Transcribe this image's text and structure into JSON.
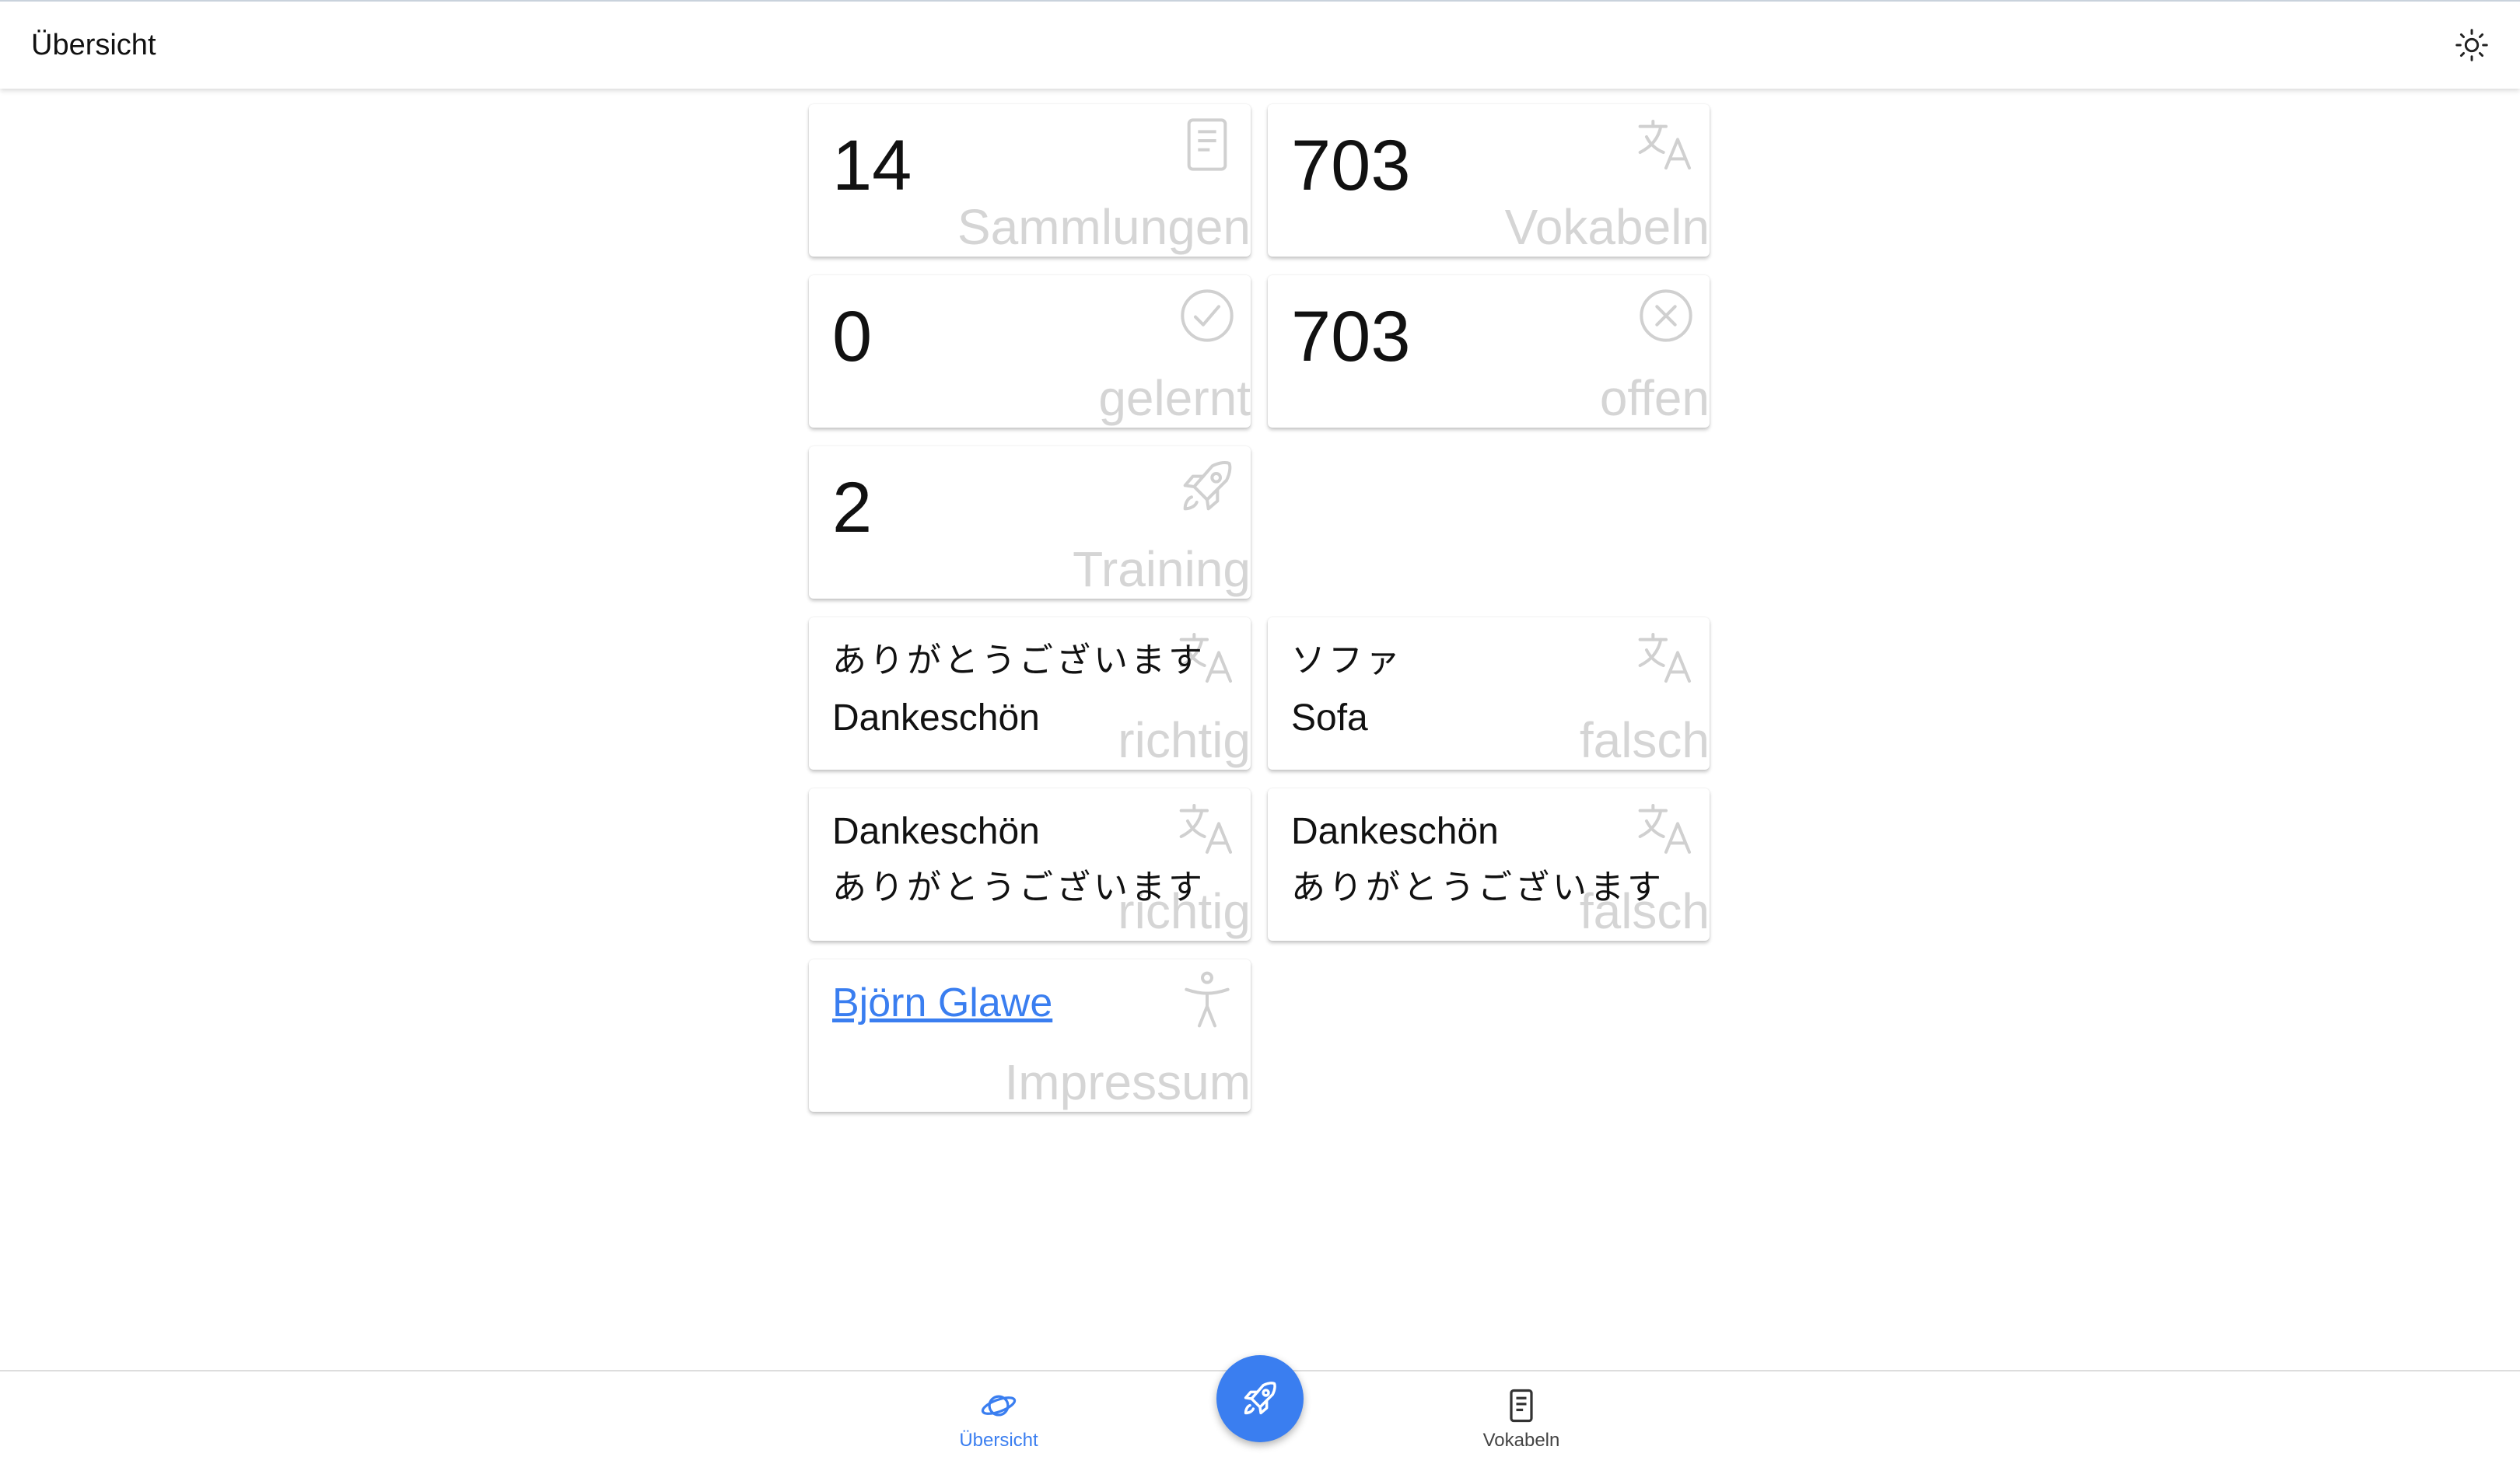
{
  "header": {
    "title": "Übersicht",
    "theme_toggle_icon": "sun-icon"
  },
  "stats": {
    "collections": {
      "value": "14",
      "label": "Sammlungen",
      "icon": "document-icon"
    },
    "vocab": {
      "value": "703",
      "label": "Vokabeln",
      "icon": "translate-icon"
    },
    "learned": {
      "value": "0",
      "label": "gelernt",
      "icon": "check-circle-icon"
    },
    "open": {
      "value": "703",
      "label": "offen",
      "icon": "x-circle-icon"
    },
    "training": {
      "value": "2",
      "label": "Training",
      "icon": "rocket-icon"
    }
  },
  "recent": [
    {
      "line1": "ありがとうございます",
      "line2": "Dankeschön",
      "label": "richtig",
      "icon": "translate-icon"
    },
    {
      "line1": "ソファ",
      "line2": "Sofa",
      "label": "falsch",
      "icon": "translate-icon"
    },
    {
      "line1": "Dankeschön",
      "line2": "ありがとうございます",
      "label": "richtig",
      "icon": "translate-icon"
    },
    {
      "line1": "Dankeschön",
      "line2": "ありがとうございます",
      "label": "falsch",
      "icon": "translate-icon"
    }
  ],
  "impressum": {
    "link_text": "Björn Glawe",
    "label": "Impressum",
    "icon": "accessibility-icon"
  },
  "bottom_nav": {
    "overview_label": "Übersicht",
    "overview_icon": "planet-icon",
    "fab_icon": "rocket-icon",
    "vocab_label": "Vokabeln",
    "vocab_icon": "document-icon"
  },
  "colors": {
    "accent": "#3a7ef0",
    "label_faded": "#d5d5d5",
    "icon_faded": "#cfcfcf"
  }
}
